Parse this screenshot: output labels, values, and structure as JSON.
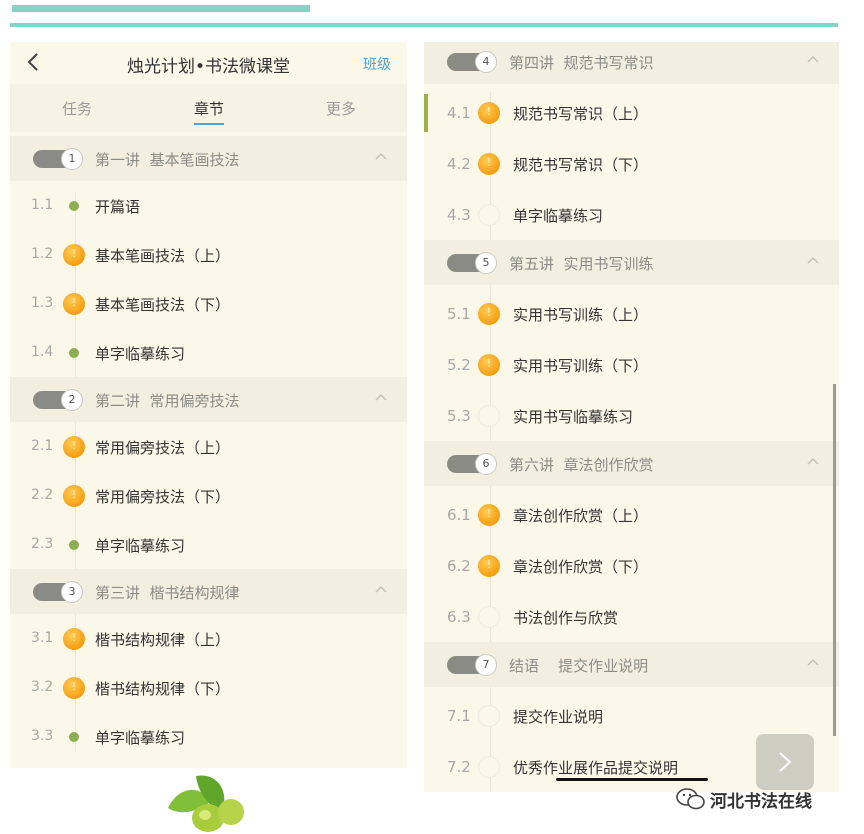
{
  "header": {
    "title": "烛光计划•书法微课堂",
    "right_link": "班级"
  },
  "tabs": [
    "任务",
    "章节",
    "更多"
  ],
  "active_tab": "章节",
  "left_panel": {
    "sections": [
      {
        "number": "1",
        "title": "第一讲  基本笔画技法",
        "items": [
          {
            "num": "1.1",
            "title": "开篇语",
            "status": "dot"
          },
          {
            "num": "1.2",
            "title": "基本笔画技法（上）",
            "status": "coin"
          },
          {
            "num": "1.3",
            "title": "基本笔画技法（下）",
            "status": "coin"
          },
          {
            "num": "1.4",
            "title": "单字临摹练习",
            "status": "dot"
          }
        ]
      },
      {
        "number": "2",
        "title": "第二讲  常用偏旁技法",
        "items": [
          {
            "num": "2.1",
            "title": "常用偏旁技法（上）",
            "status": "coin"
          },
          {
            "num": "2.2",
            "title": "常用偏旁技法（下）",
            "status": "coin"
          },
          {
            "num": "2.3",
            "title": "单字临摹练习",
            "status": "dot"
          }
        ]
      },
      {
        "number": "3",
        "title": "第三讲  楷书结构规律",
        "items": [
          {
            "num": "3.1",
            "title": "楷书结构规律（上）",
            "status": "coin"
          },
          {
            "num": "3.2",
            "title": "楷书结构规律（下）",
            "status": "coin"
          },
          {
            "num": "3.3",
            "title": "单字临摹练习",
            "status": "dot"
          }
        ]
      }
    ]
  },
  "right_panel": {
    "sections": [
      {
        "number": "4",
        "title": "第四讲  规范书写常识",
        "items": [
          {
            "num": "4.1",
            "title": "规范书写常识（上）",
            "status": "coin"
          },
          {
            "num": "4.2",
            "title": "规范书写常识（下）",
            "status": "coin"
          },
          {
            "num": "4.3",
            "title": "单字临摹练习",
            "status": "empty"
          }
        ]
      },
      {
        "number": "5",
        "title": "第五讲  实用书写训练",
        "items": [
          {
            "num": "5.1",
            "title": "实用书写训练（上）",
            "status": "coin"
          },
          {
            "num": "5.2",
            "title": "实用书写训练（下）",
            "status": "coin"
          },
          {
            "num": "5.3",
            "title": "实用书写临摹练习",
            "status": "empty"
          }
        ]
      },
      {
        "number": "6",
        "title": "第六讲  章法创作欣赏",
        "items": [
          {
            "num": "6.1",
            "title": "章法创作欣赏（上）",
            "status": "coin"
          },
          {
            "num": "6.2",
            "title": "章法创作欣赏（下）",
            "status": "coin"
          },
          {
            "num": "6.3",
            "title": "书法创作与欣赏",
            "status": "empty"
          }
        ]
      },
      {
        "number": "7",
        "title": "结语    提交作业说明",
        "items": [
          {
            "num": "7.1",
            "title": "提交作业说明",
            "status": "empty"
          },
          {
            "num": "7.2",
            "title": "优秀作业展作品提交说明",
            "status": "empty"
          }
        ]
      }
    ]
  },
  "watermark": "河北书法在线",
  "icons": [
    "back-icon",
    "chevron-up-icon",
    "coin-icon",
    "dot-icon",
    "next-arrow-icon",
    "wechat-icon",
    "leaves-icon"
  ],
  "colors": {
    "accent": "#4aa3d8",
    "teal_bar": "#84d3c3",
    "panel_bg": "#fbf8ea",
    "coin": "#f59e10",
    "dot": "#8fac52"
  }
}
